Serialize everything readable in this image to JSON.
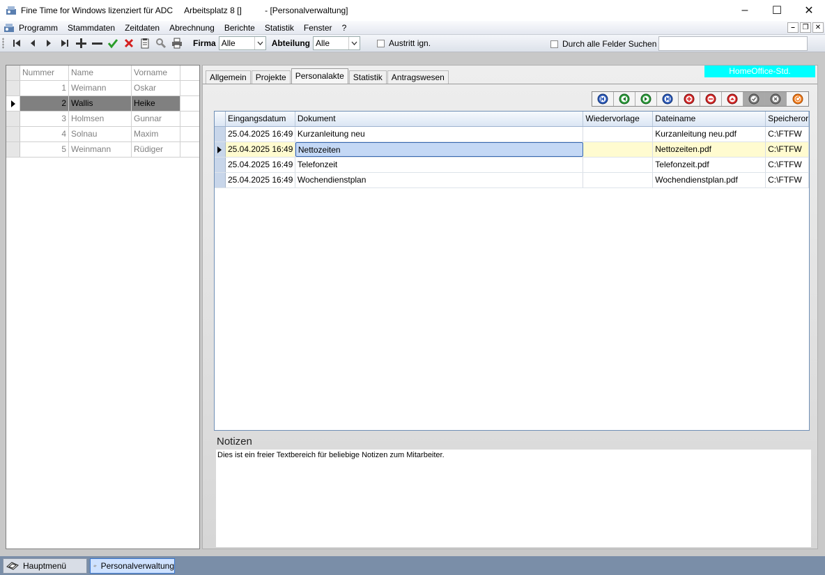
{
  "window": {
    "title": "Fine Time for Windows lizenziert für ADC     Arbeitsplatz 8 []          - [Personalverwaltung]",
    "minimize": "–",
    "maximize": "☐",
    "close": "✕"
  },
  "menu": {
    "items": [
      "Programm",
      "Stammdaten",
      "Zeitdaten",
      "Abrechnung",
      "Berichte",
      "Statistik",
      "Fenster",
      "?"
    ],
    "mdi_minimize": "–",
    "mdi_restore": "❐",
    "mdi_close": "✕"
  },
  "toolbar": {
    "firma_label": "Firma",
    "firma_value": "Alle",
    "abteilung_label": "Abteilung",
    "abteilung_value": "Alle",
    "austritt_label": "Austritt ign.",
    "search_label": "Durch alle Felder Suchen",
    "search_value": ""
  },
  "employees": {
    "headers": [
      "Nummer",
      "Name",
      "Vorname"
    ],
    "rows": [
      {
        "nummer": "1",
        "name": "Weimann",
        "vorname": "Oskar"
      },
      {
        "nummer": "2",
        "name": "Wallis",
        "vorname": "Heike"
      },
      {
        "nummer": "3",
        "name": "Holmsen",
        "vorname": "Gunnar"
      },
      {
        "nummer": "4",
        "name": "Solnau",
        "vorname": "Maxim"
      },
      {
        "nummer": "5",
        "name": "Weinmann",
        "vorname": "Rüdiger"
      }
    ],
    "selected_index": 1
  },
  "tabs": [
    "Allgemein",
    "Projekte",
    "Personalakte",
    "Statistik",
    "Antragswesen"
  ],
  "active_tab": "Personalakte",
  "homeoffice_badge": "HomeOffice-Std.",
  "documents": {
    "headers": [
      "Eingangsdatum",
      "Dokument",
      "Wiedervorlage",
      "Dateiname",
      "Speicheror"
    ],
    "rows": [
      {
        "datum": "25.04.2025 16:49",
        "dokument": "Kurzanleitung neu",
        "wiedervorlage": "",
        "dateiname": "Kurzanleitung neu.pdf",
        "speicherort": "C:\\FTFW"
      },
      {
        "datum": "25.04.2025 16:49",
        "dokument": "Nettozeiten",
        "wiedervorlage": "",
        "dateiname": "Nettozeiten.pdf",
        "speicherort": "C:\\FTFW"
      },
      {
        "datum": "25.04.2025 16:49",
        "dokument": "Telefonzeit",
        "wiedervorlage": "",
        "dateiname": "Telefonzeit.pdf",
        "speicherort": "C:\\FTFW"
      },
      {
        "datum": "25.04.2025 16:49",
        "dokument": "Wochendienstplan",
        "wiedervorlage": "",
        "dateiname": "Wochendienstplan.pdf",
        "speicherort": "C:\\FTFW"
      }
    ],
    "selected_index": 1
  },
  "notes": {
    "label": "Notizen",
    "text": "Dies ist ein freier Textbereich für beliebige Notizen zum Mitarbeiter."
  },
  "taskbar": {
    "items": [
      "Hauptmenü",
      "Personalverwaltung"
    ],
    "active": "Personalverwaltung"
  },
  "colors": {
    "homeoffice_bg": "#00ffff",
    "selected_row": "#fffbd0",
    "taskbar": "#7a8ea8"
  }
}
